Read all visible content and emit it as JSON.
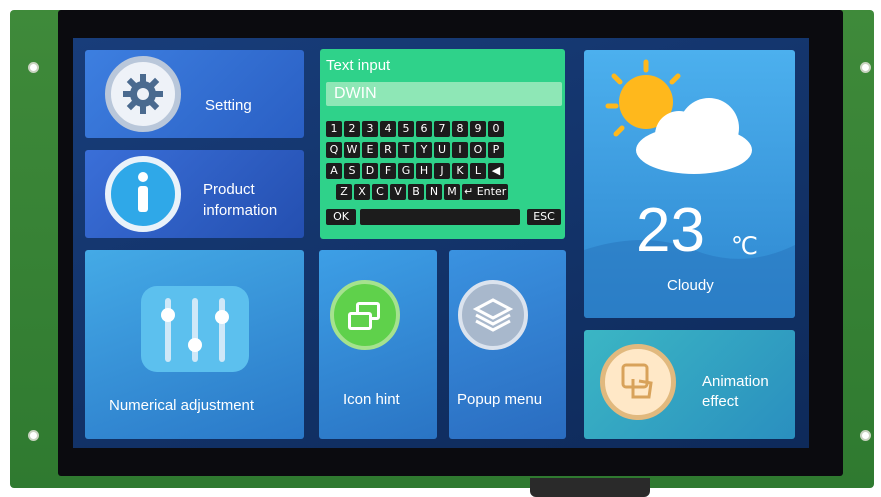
{
  "tiles": {
    "setting": {
      "label": "Setting"
    },
    "product": {
      "label_line1": "Product",
      "label_line2": "information"
    },
    "numerical": {
      "label": "Numerical adjustment"
    },
    "icon_hint": {
      "label": "Icon hint"
    },
    "popup": {
      "label": "Popup menu"
    },
    "animation": {
      "label_line1": "Animation",
      "label_line2": "effect"
    }
  },
  "keyboard": {
    "title": "Text input",
    "value": "DWIN",
    "rows": [
      [
        "1",
        "2",
        "3",
        "4",
        "5",
        "6",
        "7",
        "8",
        "9",
        "0"
      ],
      [
        "Q",
        "W",
        "E",
        "R",
        "T",
        "Y",
        "U",
        "I",
        "O",
        "P"
      ],
      [
        "A",
        "S",
        "D",
        "F",
        "G",
        "H",
        "J",
        "K",
        "L",
        "◀"
      ],
      [
        "Z",
        "X",
        "C",
        "V",
        "B",
        "N",
        "M",
        "↵ Enter"
      ]
    ],
    "ok": "OK",
    "esc": "ESC"
  },
  "weather": {
    "temperature": "23",
    "unit": "℃",
    "condition": "Cloudy"
  },
  "colors": {
    "tile_blue": "#2a5fc4",
    "keyboard_green": "#2fd28a",
    "weather_sky": "#3fa0e0"
  }
}
